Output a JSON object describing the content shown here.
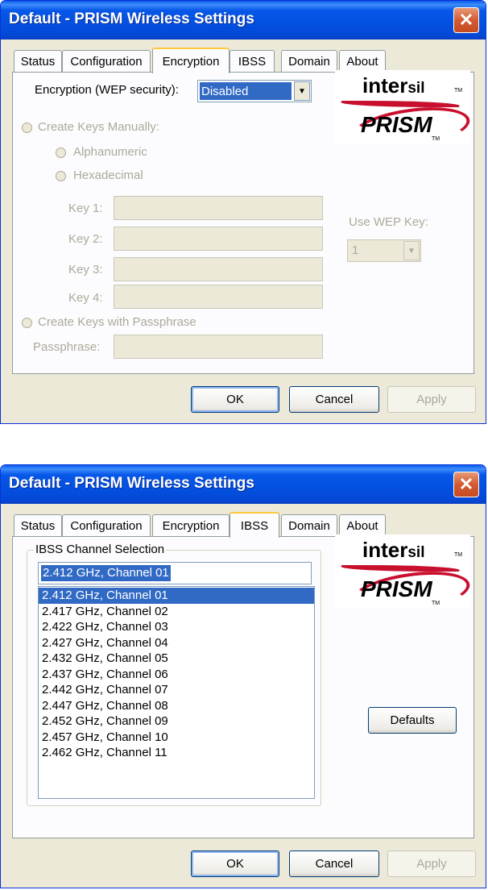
{
  "window1": {
    "title": "Default - PRISM Wireless Settings",
    "tabs": [
      {
        "label": "Status"
      },
      {
        "label": "Configuration"
      },
      {
        "label": "Encryption"
      },
      {
        "label": "IBSS"
      },
      {
        "label": "Domain"
      },
      {
        "label": "About"
      }
    ],
    "active_tab": "Encryption",
    "logo": {
      "brand": "inter",
      "brand_suffix": "sil",
      "product": "PRISM",
      "tm": "TM"
    },
    "encryption_label": "Encryption (WEP security):",
    "encryption_value": "Disabled",
    "create_keys_manually": "Create Keys Manually:",
    "alphanumeric": "Alphanumeric",
    "hexadecimal": "Hexadecimal",
    "key_labels": [
      "Key 1:",
      "Key 2:",
      "Key 3:",
      "Key 4:"
    ],
    "use_wep_key_label": "Use WEP Key:",
    "use_wep_key_value": "1",
    "create_keys_passphrase": "Create Keys with Passphrase",
    "passphrase_label": "Passphrase:",
    "buttons": {
      "ok": "OK",
      "cancel": "Cancel",
      "apply": "Apply"
    }
  },
  "window2": {
    "title": "Default - PRISM Wireless Settings",
    "tabs": [
      {
        "label": "Status"
      },
      {
        "label": "Configuration"
      },
      {
        "label": "Encryption"
      },
      {
        "label": "IBSS"
      },
      {
        "label": "Domain"
      },
      {
        "label": "About"
      }
    ],
    "active_tab": "IBSS",
    "logo": {
      "brand": "inter",
      "brand_suffix": "sil",
      "product": "PRISM",
      "tm": "TM"
    },
    "group_title": "IBSS Channel Selection",
    "selected_channel": "2.412 GHz, Channel 01",
    "channels": [
      "2.412 GHz, Channel 01",
      "2.417 GHz, Channel 02",
      "2.422 GHz, Channel 03",
      "2.427 GHz, Channel 04",
      "2.432 GHz, Channel 05",
      "2.437 GHz, Channel 06",
      "2.442 GHz, Channel 07",
      "2.447 GHz, Channel 08",
      "2.452 GHz, Channel 09",
      "2.457 GHz, Channel 10",
      "2.462 GHz, Channel 11"
    ],
    "defaults_button": "Defaults",
    "buttons": {
      "ok": "OK",
      "cancel": "Cancel",
      "apply": "Apply"
    }
  },
  "colors": {
    "title_bar": "#0450e0",
    "dialog_bg": "#ece9d8",
    "selection": "#316ac5",
    "close_button": "#d35a30",
    "disabled_text": "#aca899",
    "logo_red": "#c8102e"
  },
  "icons": {
    "close": "close-icon",
    "dropdown": "chevron-down-icon"
  }
}
